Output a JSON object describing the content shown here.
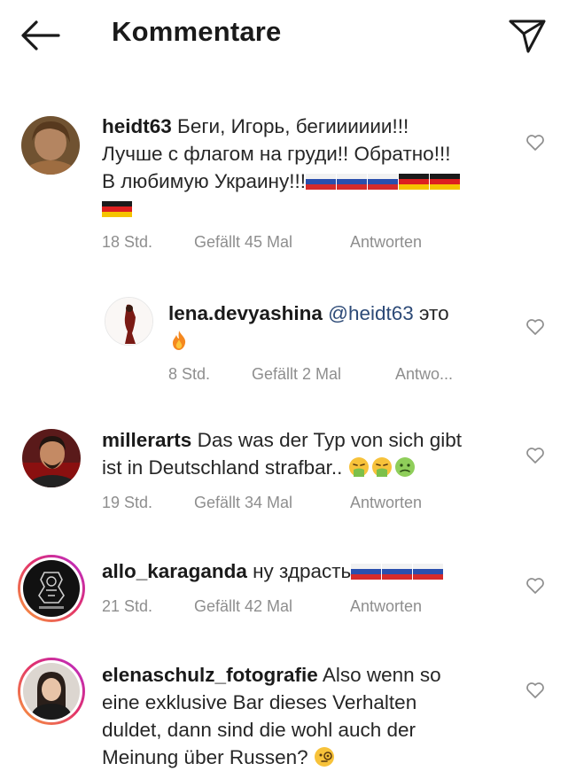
{
  "header": {
    "title": "Kommentare",
    "back_icon": "arrow-left-icon",
    "send_icon": "paper-plane-icon"
  },
  "comments": [
    {
      "username": "heidt63",
      "lines": [
        "Беги, Игорь, бегииииии!!!",
        "Лучше с флагом на груди!! Обратно!!!",
        "В любимую Украину!!!"
      ],
      "flags": [
        "ru-flag",
        "ru-flag",
        "ru-flag",
        "de-flag",
        "de-flag",
        "de-flag"
      ],
      "time": "18 Std.",
      "likes": "Gefällt 45 Mal",
      "reply": "Antworten"
    },
    {
      "username": "lena.devyashina",
      "mention": "@heidt63",
      "text": "это",
      "emoji": "fire-emoji",
      "time": "8 Std.",
      "likes": "Gefällt 2 Mal",
      "reply": "Antwo..."
    },
    {
      "username": "millerarts",
      "lines": [
        "Das was der Typ von sich gibt",
        "ist in Deutschland strafbar.."
      ],
      "emojis": [
        "vomiting-face-emoji",
        "vomiting-face-emoji",
        "nauseated-face-emoji"
      ],
      "time": "19 Std.",
      "likes": "Gefällt 34 Mal",
      "reply": "Antworten"
    },
    {
      "username": "allo_karaganda",
      "text": "ну здрасть",
      "flags": [
        "ru-flag",
        "ru-flag",
        "ru-flag"
      ],
      "time": "21 Std.",
      "likes": "Gefällt 42 Mal",
      "reply": "Antworten"
    },
    {
      "username": "elenaschulz_fotografie",
      "lines": [
        "Also wenn so",
        "eine exklusive Bar dieses Verhalten",
        "duldet, dann sind die wohl auch der",
        "Meinung über Russen?"
      ],
      "emoji": "face-with-monocle-emoji"
    }
  ],
  "colors": {
    "text": "#262626",
    "meta": "#8e8e8e",
    "mention": "#2d4a77",
    "ring_start": "#f9a03a",
    "ring_end": "#b52bd1"
  },
  "icons": {
    "like": "heart-outline-icon"
  }
}
